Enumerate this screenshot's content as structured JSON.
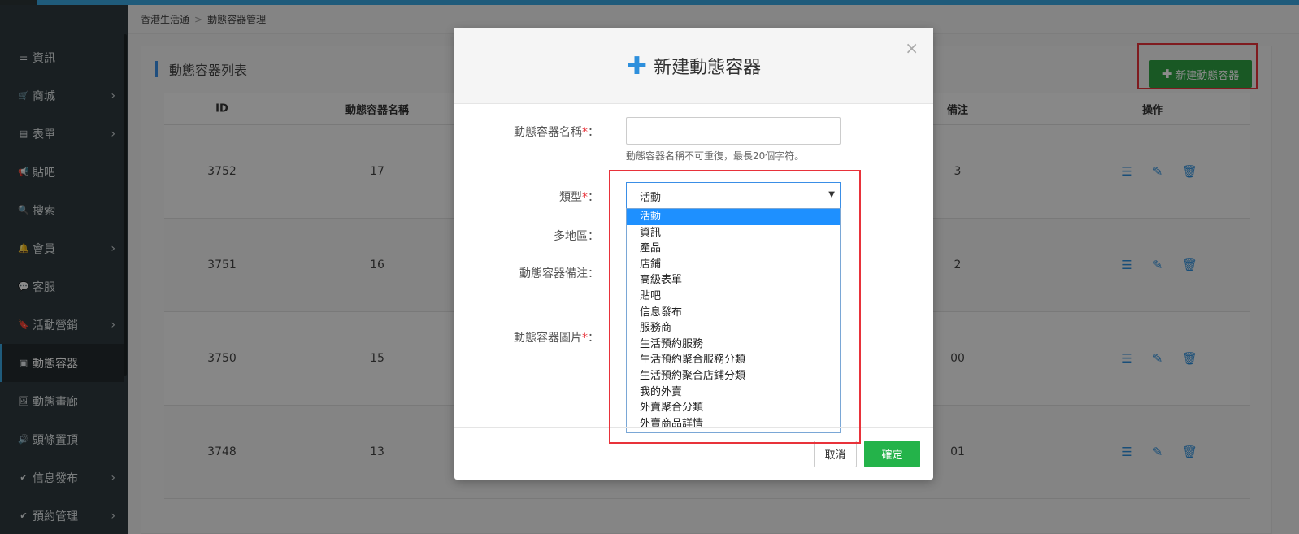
{
  "breadcrumb": [
    "香港生活通",
    "動態容器管理"
  ],
  "sidebar": {
    "items": [
      {
        "label": "資訊",
        "icon": "list-icon",
        "glyph": "☰",
        "chevron": false
      },
      {
        "label": "商城",
        "icon": "cart-icon",
        "glyph": "🛒",
        "chevron": true
      },
      {
        "label": "表單",
        "icon": "form-icon",
        "glyph": "▤",
        "chevron": true
      },
      {
        "label": "貼吧",
        "icon": "bullhorn-icon",
        "glyph": "📢",
        "chevron": false
      },
      {
        "label": "搜索",
        "icon": "search-icon",
        "glyph": "🔍",
        "chevron": false
      },
      {
        "label": "會員",
        "icon": "bell-icon",
        "glyph": "🔔",
        "chevron": true
      },
      {
        "label": "客服",
        "icon": "chat-icon",
        "glyph": "💬",
        "chevron": false
      },
      {
        "label": "活動營銷",
        "icon": "bookmark-icon",
        "glyph": "🔖",
        "chevron": true
      },
      {
        "label": "動態容器",
        "icon": "inbox-icon",
        "glyph": "▣",
        "chevron": false,
        "active": true
      },
      {
        "label": "動態畫廊",
        "icon": "picture-icon",
        "glyph": "🖼",
        "chevron": false
      },
      {
        "label": "頭條置頂",
        "icon": "volume-icon",
        "glyph": "🔊",
        "chevron": false
      },
      {
        "label": "信息發布",
        "icon": "check-icon",
        "glyph": "✔",
        "chevron": true
      },
      {
        "label": "預約管理",
        "icon": "check-icon",
        "glyph": "✔",
        "chevron": true
      }
    ]
  },
  "panel": {
    "title": "動態容器列表",
    "new_button": "新建動態容器"
  },
  "table": {
    "headers": {
      "id": "ID",
      "name": "動態容器名稱",
      "remark": "備注",
      "ops": "操作"
    },
    "rows": [
      {
        "id": "3752",
        "name": "17",
        "remark": "3"
      },
      {
        "id": "3751",
        "name": "16",
        "remark": "2"
      },
      {
        "id": "3750",
        "name": "15",
        "remark": "00"
      },
      {
        "id": "3748",
        "name": "13",
        "remark": "01"
      }
    ]
  },
  "modal": {
    "title": "新建動態容器",
    "close": "×",
    "fields": {
      "name_label": "動態容器名稱",
      "name_value": "",
      "name_help": "動態容器名稱不可重復，最長20個字符。",
      "type_label": "類型",
      "type_value": "活動",
      "region_label": "多地區",
      "remark_label": "動態容器備注",
      "image_label": "動態容器圖片",
      "required_mark": "*",
      "colon": "："
    },
    "type_options": [
      "活動",
      "資訊",
      "產品",
      "店鋪",
      "高級表單",
      "貼吧",
      "信息發布",
      "服務商",
      "生活預約服務",
      "生活預約聚合服務分類",
      "生活預約聚合店鋪分類",
      "我的外賣",
      "外賣聚合分類",
      "外賣商品詳情"
    ],
    "cancel": "取消",
    "confirm": "確定"
  },
  "colors": {
    "accent": "#3aa7e0",
    "sidebar_bg": "#2f3a3f",
    "success": "#2ea043",
    "highlight": "#e8323a",
    "selected_option": "#1e90ff"
  }
}
